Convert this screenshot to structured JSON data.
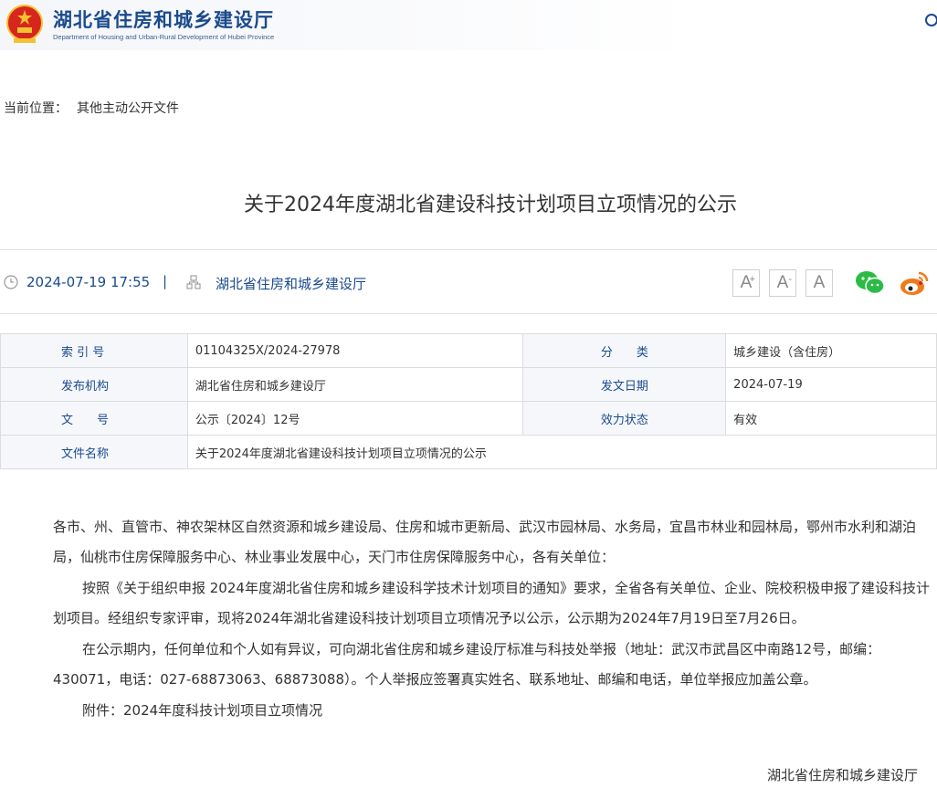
{
  "header": {
    "site_title": "湖北省住房和城乡建设厅",
    "site_subtitle": "Department of Housing and Urban-Rural Development of Hubei Province",
    "emblem_icon": "national-emblem-icon",
    "search_icon": "search-icon"
  },
  "breadcrumb": {
    "label": "当前位置：",
    "current": "其他主动公开文件"
  },
  "article": {
    "title": "关于2024年度湖北省建设科技计划项目立项情况的公示"
  },
  "meta": {
    "date": "2024-07-19 17:55",
    "separator": "|",
    "source": "湖北省住房和城乡建设厅",
    "font_large": "A",
    "font_large_mark": "+",
    "font_small": "A",
    "font_small_mark": "-",
    "font_reset": "A",
    "share_icons": [
      "wechat-icon",
      "weibo-icon"
    ]
  },
  "info_table": {
    "rows": [
      {
        "label1": "索 引 号",
        "value1": "01104325X/2024-27978",
        "label2": "分　　类",
        "value2": "城乡建设（含住房）"
      },
      {
        "label1": "发布机构",
        "value1": "湖北省住房和城乡建设厅",
        "label2": "发文日期",
        "value2": "2024-07-19"
      },
      {
        "label1": "文　　号",
        "value1": "公示〔2024〕12号",
        "label2": "效力状态",
        "value2": "有效"
      }
    ],
    "name_label": "文件名称",
    "name_value": "关于2024年度湖北省建设科技计划项目立项情况的公示"
  },
  "content": {
    "greeting": "各市、州、直管市、神农架林区自然资源和城乡建设局、住房和城市更新局、武汉市园林局、水务局，宜昌市林业和园林局，鄂州市水利和湖泊局，仙桃市住房保障服务中心、林业事业发展中心，天门市住房保障服务中心，各有关单位：",
    "paragraph1": "按照《关于组织申报 2024年度湖北省住房和城乡建设科学技术计划项目的通知》要求，全省各有关单位、企业、院校积极申报了建设科技计划项目。经组织专家评审，现将2024年湖北省建设科技计划项目立项情况予以公示，公示期为2024年7月19日至7月26日。",
    "paragraph2": "在公示期内，任何单位和个人如有异议，可向湖北省住房和城乡建设厅标准与科技处举报（地址：武汉市武昌区中南路12号，邮编：430071，电话：027-68873063、68873088）。个人举报应签署真实姓名、联系地址、邮编和电话，单位举报应加盖公章。",
    "attachment": "附件：2024年度科技计划项目立项情况",
    "signature": "湖北省住房和城乡建设厅"
  },
  "colors": {
    "brand_blue": "#1a4a8c",
    "emblem_red": "#d7261e",
    "emblem_gold": "#f2c230",
    "wechat_green": "#2bbb47",
    "weibo_orange": "#f07b1b"
  }
}
